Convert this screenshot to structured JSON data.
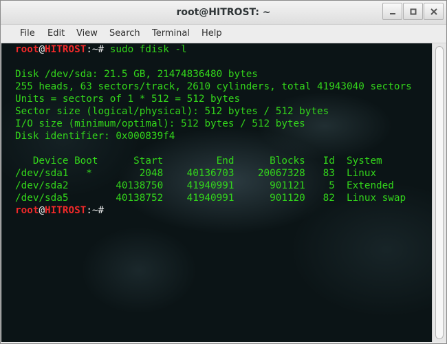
{
  "window": {
    "title": "root@HITROST: ~",
    "buttons": [
      "minimize",
      "maximize",
      "close"
    ]
  },
  "menu": [
    "File",
    "Edit",
    "View",
    "Search",
    "Terminal",
    "Help"
  ],
  "terminal": {
    "prompt": {
      "user": "root",
      "at": "@",
      "host": "HITROST",
      "path": ":~#"
    },
    "command": " sudo fdisk -l",
    "output": [
      "Disk /dev/sda: 21.5 GB, 21474836480 bytes",
      "255 heads, 63 sectors/track, 2610 cylinders, total 41943040 sectors",
      "Units = sectors of 1 * 512 = 512 bytes",
      "Sector size (logical/physical): 512 bytes / 512 bytes",
      "I/O size (minimum/optimal): 512 bytes / 512 bytes",
      "Disk identifier: 0x000839f4"
    ],
    "table_header": "   Device Boot      Start         End      Blocks   Id  System",
    "table_rows": [
      "/dev/sda1   *        2048    40136703    20067328   83  Linux",
      "/dev/sda2        40138750    41940991      901121    5  Extended",
      "/dev/sda5        40138752    41940991      901120   82  Linux swap"
    ],
    "prompt2": {
      "user": "root",
      "at": "@",
      "host": "HITROST",
      "path": ":~#"
    }
  },
  "colors": {
    "text": "#33d61b",
    "prompt": "#ef2929",
    "background": "#0b1416"
  }
}
